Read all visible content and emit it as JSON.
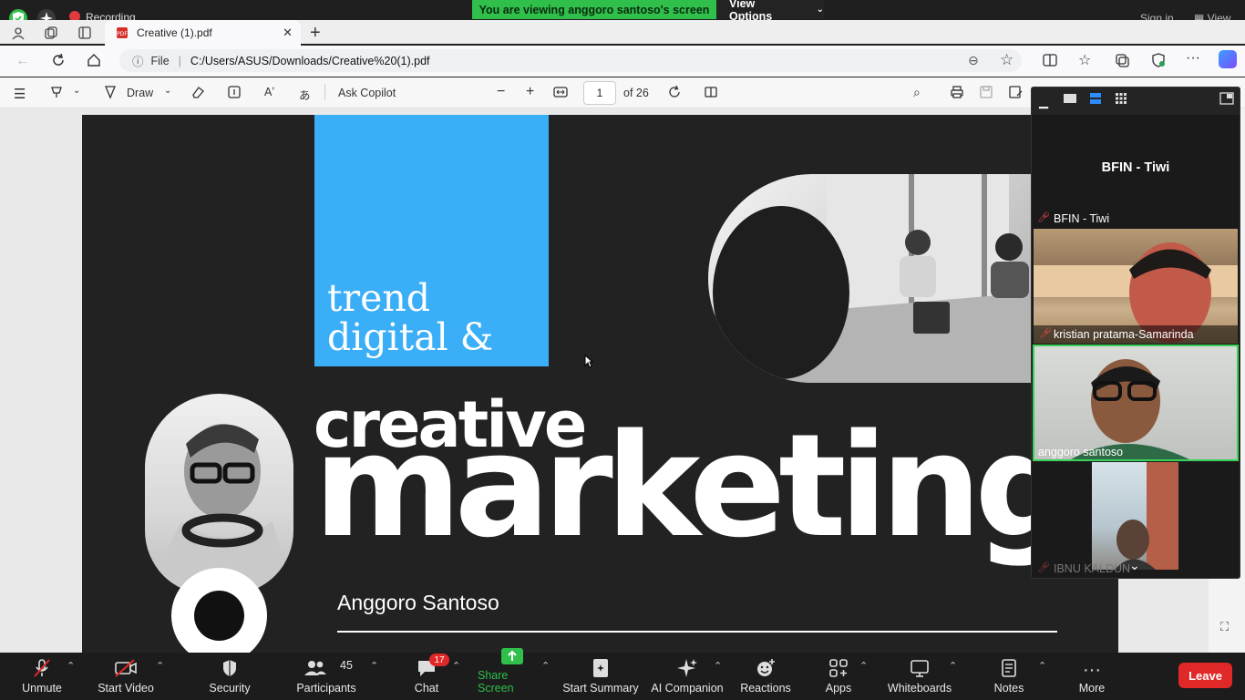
{
  "zoom_top": {
    "recording_label": "Recording",
    "banner_text": "You are viewing anggoro santoso's screen",
    "view_options_label": "View Options",
    "sign_in_label": "Sign in",
    "view_label": "View"
  },
  "browser": {
    "tab_title": "Creative (1).pdf",
    "url_prefix": "File",
    "url": "C:/Users/ASUS/Downloads/Creative%20(1).pdf"
  },
  "pdf_toolbar": {
    "draw_label": "Draw",
    "ask_copilot_label": "Ask Copilot",
    "page_current": "1",
    "page_total": "of 26"
  },
  "slide": {
    "line1": "trend",
    "line2": "digital &",
    "headline_small": "creative",
    "headline_large": "marketing",
    "author": "Anggoro Santoso"
  },
  "gallery": {
    "active_name": "BFIN - Tiwi",
    "participants": [
      {
        "name": "BFIN - Tiwi",
        "muted": true
      },
      {
        "name": "kristian pratama-Samarinda",
        "muted": true
      },
      {
        "name": "anggoro santoso",
        "muted": false
      },
      {
        "name": "IBNU KALDUN",
        "muted": true
      }
    ]
  },
  "controls": {
    "unmute": "Unmute",
    "start_video": "Start Video",
    "security": "Security",
    "participants": "Participants",
    "participant_count": "45",
    "chat": "Chat",
    "chat_badge": "17",
    "share_screen": "Share Screen",
    "start_summary": "Start Summary",
    "ai_companion": "AI Companion",
    "reactions": "Reactions",
    "apps": "Apps",
    "whiteboards": "Whiteboards",
    "notes": "Notes",
    "more": "More",
    "leave": "Leave"
  },
  "colors": {
    "share_banner": "#2fbf4a",
    "slide_accent": "#3aaef7",
    "leave": "#e02828",
    "active_speaker_border": "#3ad35a"
  }
}
